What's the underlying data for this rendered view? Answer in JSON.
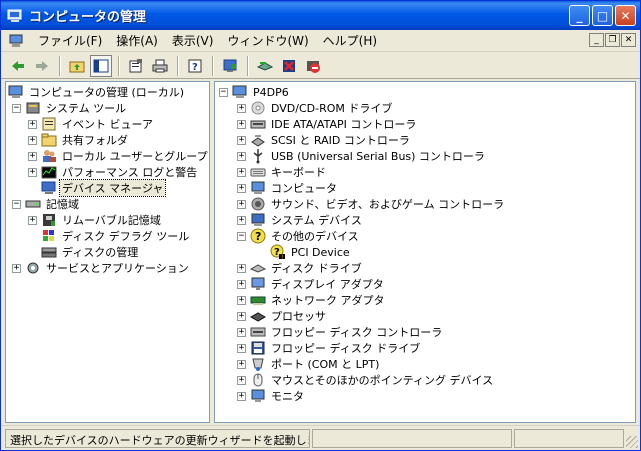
{
  "window": {
    "title": "コンピュータの管理",
    "controls": {
      "minimize": "_",
      "maximize": "□",
      "close": "✕"
    }
  },
  "menubar": {
    "items": [
      {
        "label": "ファイル(F)"
      },
      {
        "label": "操作(A)"
      },
      {
        "label": "表示(V)"
      },
      {
        "label": "ウィンドウ(W)"
      },
      {
        "label": "ヘルプ(H)"
      }
    ],
    "mdi_controls": {
      "minimize": "_",
      "restore": "❐",
      "close": "✕"
    }
  },
  "toolbar": {
    "icons": [
      "back-icon",
      "forward-icon",
      "up-folder-icon",
      "show-hide-tree-icon",
      "properties-icon",
      "print-icon",
      "help-icon",
      "update-driver-icon",
      "scan-hardware-icon",
      "uninstall-icon",
      "disable-device-icon"
    ]
  },
  "left_tree": {
    "root": "コンピュータの管理 (ローカル)",
    "items": [
      {
        "label": "システム ツール",
        "level": 1,
        "expander": "−",
        "icon": "tools-icon"
      },
      {
        "label": "イベント ビューア",
        "level": 2,
        "expander": "+",
        "icon": "event-viewer-icon"
      },
      {
        "label": "共有フォルダ",
        "level": 2,
        "expander": "+",
        "icon": "shared-folder-icon"
      },
      {
        "label": "ローカル ユーザーとグループ",
        "level": 2,
        "expander": "+",
        "icon": "users-icon"
      },
      {
        "label": "パフォーマンス ログと警告",
        "level": 2,
        "expander": "+",
        "icon": "performance-icon"
      },
      {
        "label": "デバイス マネージャ",
        "level": 2,
        "expander": "",
        "icon": "device-manager-icon",
        "selected": true
      },
      {
        "label": "記憶域",
        "level": 1,
        "expander": "−",
        "icon": "storage-icon"
      },
      {
        "label": "リムーバブル記憶域",
        "level": 2,
        "expander": "+",
        "icon": "removable-storage-icon"
      },
      {
        "label": "ディスク デフラグ ツール",
        "level": 2,
        "expander": "",
        "icon": "defrag-icon"
      },
      {
        "label": "ディスクの管理",
        "level": 2,
        "expander": "",
        "icon": "disk-management-icon"
      },
      {
        "label": "サービスとアプリケーション",
        "level": 1,
        "expander": "+",
        "icon": "services-icon"
      }
    ]
  },
  "right_tree": {
    "root": "P4DP6",
    "items": [
      {
        "label": "DVD/CD-ROM ドライブ",
        "level": 1,
        "expander": "+",
        "icon": "cdrom-icon"
      },
      {
        "label": "IDE ATA/ATAPI コントローラ",
        "level": 1,
        "expander": "+",
        "icon": "ide-icon"
      },
      {
        "label": "SCSI と RAID コントローラ",
        "level": 1,
        "expander": "+",
        "icon": "scsi-icon"
      },
      {
        "label": "USB (Universal Serial Bus) コントローラ",
        "level": 1,
        "expander": "+",
        "icon": "usb-icon"
      },
      {
        "label": "キーボード",
        "level": 1,
        "expander": "+",
        "icon": "keyboard-icon"
      },
      {
        "label": "コンピュータ",
        "level": 1,
        "expander": "+",
        "icon": "computer-icon"
      },
      {
        "label": "サウンド、ビデオ、およびゲーム コントローラ",
        "level": 1,
        "expander": "+",
        "icon": "sound-icon"
      },
      {
        "label": "システム デバイス",
        "level": 1,
        "expander": "+",
        "icon": "system-device-icon"
      },
      {
        "label": "その他のデバイス",
        "level": 1,
        "expander": "−",
        "icon": "unknown-device-icon"
      },
      {
        "label": "PCI Device",
        "level": 2,
        "expander": "",
        "icon": "warning-device-icon"
      },
      {
        "label": "ディスク ドライブ",
        "level": 1,
        "expander": "+",
        "icon": "disk-drive-icon"
      },
      {
        "label": "ディスプレイ アダプタ",
        "level": 1,
        "expander": "+",
        "icon": "display-adapter-icon"
      },
      {
        "label": "ネットワーク アダプタ",
        "level": 1,
        "expander": "+",
        "icon": "network-adapter-icon"
      },
      {
        "label": "プロセッサ",
        "level": 1,
        "expander": "+",
        "icon": "processor-icon"
      },
      {
        "label": "フロッピー ディスク コントローラ",
        "level": 1,
        "expander": "+",
        "icon": "floppy-controller-icon"
      },
      {
        "label": "フロッピー ディスク ドライブ",
        "level": 1,
        "expander": "+",
        "icon": "floppy-drive-icon"
      },
      {
        "label": "ポート (COM と LPT)",
        "level": 1,
        "expander": "+",
        "icon": "port-icon"
      },
      {
        "label": "マウスとそのほかのポインティング デバイス",
        "level": 1,
        "expander": "+",
        "icon": "mouse-icon"
      },
      {
        "label": "モニタ",
        "level": 1,
        "expander": "+",
        "icon": "monitor-icon"
      }
    ]
  },
  "statusbar": {
    "text": "選択したデバイスのハードウェアの更新ウィザードを起動します。"
  }
}
